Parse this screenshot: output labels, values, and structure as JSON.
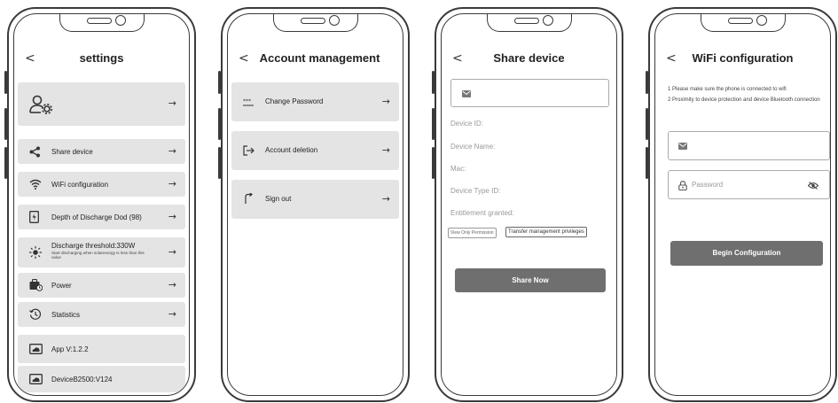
{
  "nav": {
    "back_symbol": "<",
    "arrow_symbol": "→"
  },
  "screens": {
    "settings": {
      "title": "settings",
      "items": [
        {
          "label": "Share device"
        },
        {
          "label": "WiFi configuration"
        },
        {
          "label": "Depth of Discharge Dod (98)"
        },
        {
          "label": "Discharge threshold:330W",
          "sub": "Start discharging when solarenergy is less than this value"
        },
        {
          "label": "Power"
        },
        {
          "label": "Statistics"
        }
      ],
      "version_app": "App V:1.2.2",
      "version_device": "DeviceB2500:V124"
    },
    "account": {
      "title": "Account management",
      "items": [
        {
          "label": "Change Password"
        },
        {
          "label": "Account deletion"
        },
        {
          "label": "Sign out"
        }
      ]
    },
    "share": {
      "title": "Share device",
      "fields": [
        "Device ID:",
        "Device Name:",
        "Mac:",
        "Device Type ID:",
        "Entitlement granted:"
      ],
      "perm_view": "View Only Permission",
      "perm_transfer": "Transfer management privileges",
      "button": "Share Now"
    },
    "wifi": {
      "title": "WiFi configuration",
      "note1": "1 Please make sure the phone is connected to wifi",
      "note2": "2 Proximity to device protection and device Bluetooth connection",
      "password_placeholder": "Password",
      "button": "Begin Configuration"
    }
  }
}
